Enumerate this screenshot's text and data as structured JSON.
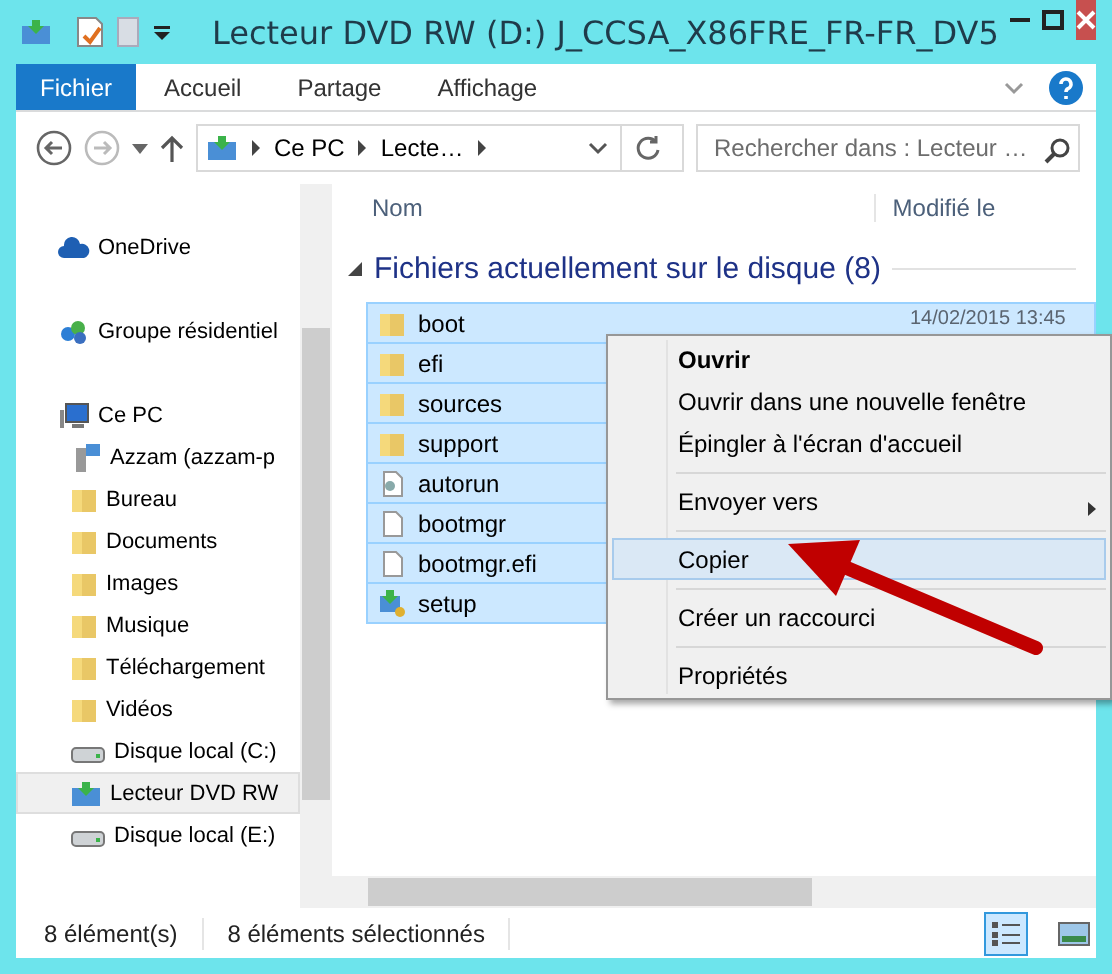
{
  "window": {
    "title": "Lecteur DVD RW (D:) J_CCSA_X86FRE_FR-FR_DV5"
  },
  "ribbon": {
    "file_tab": "Fichier",
    "tabs": [
      "Accueil",
      "Partage",
      "Affichage"
    ]
  },
  "address": {
    "crumbs": [
      "Ce PC",
      "Lecte…"
    ],
    "search_placeholder": "Rechercher dans : Lecteur …"
  },
  "sidebar": {
    "groups": [
      {
        "items": [
          {
            "label": "OneDrive",
            "kind": "cloud",
            "selected": false
          }
        ]
      },
      {
        "items": [
          {
            "label": "Groupe résidentiel",
            "kind": "homegroup",
            "selected": false
          }
        ]
      },
      {
        "items": [
          {
            "label": "Ce PC",
            "kind": "pc",
            "selected": false,
            "children": [
              {
                "label": "Azzam (azzam-p",
                "kind": "user",
                "selected": false
              },
              {
                "label": "Bureau",
                "kind": "folder",
                "selected": false
              },
              {
                "label": "Documents",
                "kind": "folder",
                "selected": false
              },
              {
                "label": "Images",
                "kind": "folder",
                "selected": false
              },
              {
                "label": "Musique",
                "kind": "folder",
                "selected": false
              },
              {
                "label": "Téléchargement",
                "kind": "folder",
                "selected": false
              },
              {
                "label": "Vidéos",
                "kind": "folder",
                "selected": false
              },
              {
                "label": "Disque local (C:)",
                "kind": "drive",
                "selected": false
              },
              {
                "label": "Lecteur DVD RW",
                "kind": "dvd",
                "selected": true
              },
              {
                "label": "Disque local (E:)",
                "kind": "drive",
                "selected": false
              }
            ]
          }
        ]
      }
    ]
  },
  "list": {
    "columns": [
      "Nom",
      "Modifié le"
    ],
    "group": "Fichiers actuellement sur le disque (8)",
    "rows": [
      {
        "name": "boot",
        "kind": "folder",
        "selected": true,
        "modified": "14/02/2015 13:45"
      },
      {
        "name": "efi",
        "kind": "folder",
        "selected": true
      },
      {
        "name": "sources",
        "kind": "folder",
        "selected": true
      },
      {
        "name": "support",
        "kind": "folder",
        "selected": true
      },
      {
        "name": "autorun",
        "kind": "settings",
        "selected": true
      },
      {
        "name": "bootmgr",
        "kind": "file",
        "selected": true
      },
      {
        "name": "bootmgr.efi",
        "kind": "file",
        "selected": true
      },
      {
        "name": "setup",
        "kind": "setup",
        "selected": true
      }
    ]
  },
  "context_menu": {
    "items": [
      {
        "label": "Ouvrir",
        "kind": "default",
        "selected": false
      },
      {
        "label": "Ouvrir dans une nouvelle fenêtre",
        "kind": "item",
        "selected": false
      },
      {
        "label": "Épingler à l'écran d'accueil",
        "kind": "item",
        "selected": false
      },
      {
        "kind": "separator"
      },
      {
        "label": "Envoyer vers",
        "kind": "submenu",
        "selected": false
      },
      {
        "kind": "separator"
      },
      {
        "label": "Copier",
        "kind": "item",
        "selected": true
      },
      {
        "kind": "separator"
      },
      {
        "label": "Créer un raccourci",
        "kind": "item",
        "selected": false
      },
      {
        "kind": "separator"
      },
      {
        "label": "Propriétés",
        "kind": "item",
        "selected": false
      }
    ]
  },
  "status_bar": {
    "count": "8 élément(s)",
    "selection": "8 éléments sélectionnés",
    "views": [
      {
        "kind": "details",
        "selected": true
      },
      {
        "kind": "large_icons",
        "selected": false
      }
    ]
  }
}
